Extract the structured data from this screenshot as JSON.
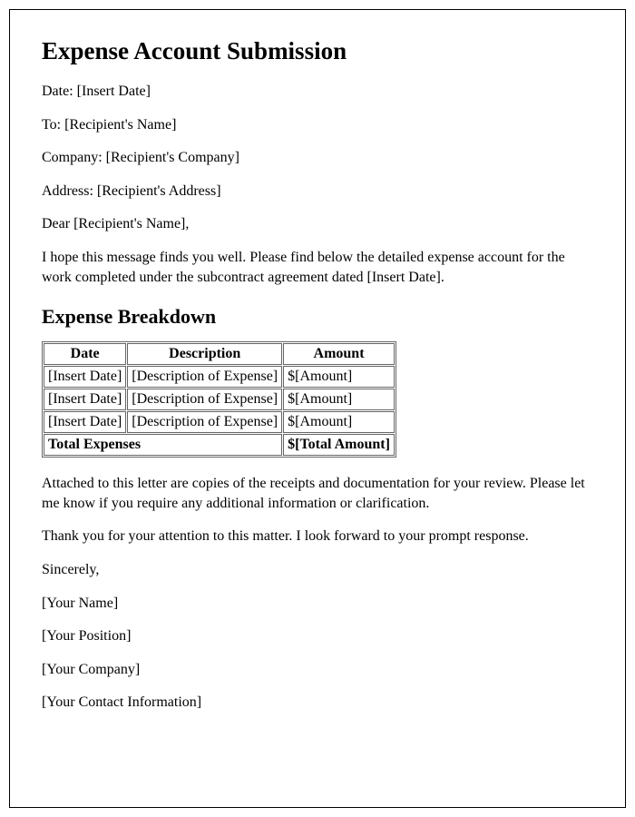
{
  "title": "Expense Account Submission",
  "meta": {
    "date_label": "Date: ",
    "date_value": "[Insert Date]",
    "to_label": "To: ",
    "to_value": "[Recipient's Name]",
    "company_label": "Company: ",
    "company_value": "[Recipient's Company]",
    "address_label": "Address: ",
    "address_value": "[Recipient's Address]"
  },
  "salutation": "Dear [Recipient's Name],",
  "intro": "I hope this message finds you well. Please find below the detailed expense account for the work completed under the subcontract agreement dated [Insert Date].",
  "breakdown_heading": "Expense Breakdown",
  "table": {
    "headers": {
      "date": "Date",
      "description": "Description",
      "amount": "Amount"
    },
    "rows": [
      {
        "date": "[Insert Date]",
        "description": "[Description of Expense]",
        "amount": "$[Amount]"
      },
      {
        "date": "[Insert Date]",
        "description": "[Description of Expense]",
        "amount": "$[Amount]"
      },
      {
        "date": "[Insert Date]",
        "description": "[Description of Expense]",
        "amount": "$[Amount]"
      }
    ],
    "total_label": "Total Expenses",
    "total_value": "$[Total Amount]"
  },
  "attachment_note": "Attached to this letter are copies of the receipts and documentation for your review. Please let me know if you require any additional information or clarification.",
  "thanks": "Thank you for your attention to this matter. I look forward to your prompt response.",
  "signoff": {
    "closing": "Sincerely,",
    "name": "[Your Name]",
    "position": "[Your Position]",
    "company": "[Your Company]",
    "contact": "[Your Contact Information]"
  }
}
